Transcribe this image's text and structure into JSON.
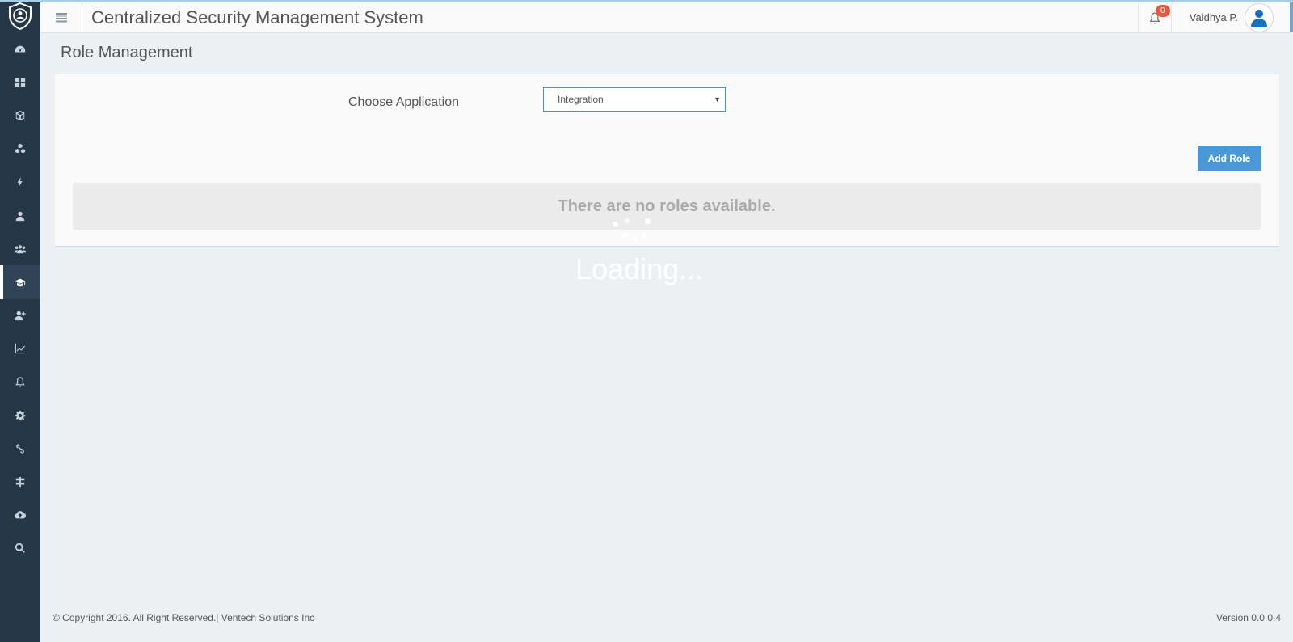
{
  "header": {
    "title": "Centralized Security Management System",
    "notification_count": "0",
    "user_name": "Vaidhya P."
  },
  "sidebar": {
    "items": [
      {
        "icon": "dashboard-gauge-icon"
      },
      {
        "icon": "grid-icon"
      },
      {
        "icon": "cube-icon"
      },
      {
        "icon": "cubes-icon"
      },
      {
        "icon": "bolt-icon"
      },
      {
        "icon": "user-icon"
      },
      {
        "icon": "users-icon"
      },
      {
        "icon": "graduation-cap-icon",
        "active": true
      },
      {
        "icon": "user-plus-icon"
      },
      {
        "icon": "line-chart-icon"
      },
      {
        "icon": "bell-icon"
      },
      {
        "icon": "gear-icon"
      },
      {
        "icon": "link-icon"
      },
      {
        "icon": "sliders-icon"
      },
      {
        "icon": "cloud-upload-icon"
      },
      {
        "icon": "search-icon"
      }
    ]
  },
  "page": {
    "title": "Role Management",
    "choose_label": "Choose Application",
    "application_value": "Integration",
    "add_role_label": "Add Role",
    "empty_message": "There are no roles available.",
    "loading_text": "Loading..."
  },
  "footer": {
    "copyright": "© Copyright 2016. All Right Reserved.| Ventech Solutions Inc",
    "version": "Version 0.0.0.4"
  },
  "colors": {
    "sidebar": "#253746",
    "accent": "#4b98d8",
    "badge": "#e9573f",
    "background": "#ecf0f3"
  }
}
